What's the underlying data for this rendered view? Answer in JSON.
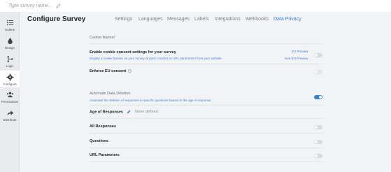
{
  "topbar": {
    "survey_placeholder": "Type survey name..."
  },
  "sidebar": {
    "items": [
      {
        "label": "Outline",
        "icon": "list-icon"
      },
      {
        "label": "Design",
        "icon": "droplet-icon"
      },
      {
        "label": "Logic",
        "icon": "logic-icon"
      },
      {
        "label": "Configure",
        "icon": "gear-icon",
        "active": true
      },
      {
        "label": "Permissions",
        "icon": "users-icon"
      },
      {
        "label": "Distribute",
        "icon": "share-icon"
      }
    ]
  },
  "header": {
    "title": "Configure Survey",
    "tabs": [
      "Settings",
      "Languages",
      "Messages",
      "Labels",
      "Integrations",
      "Webhooks",
      "Data Privacy"
    ],
    "active_tab": "Data Privacy"
  },
  "cookie": {
    "section_title": "Cookie Banner",
    "enable_label": "Enable cookie consent settings for your survey",
    "enable_sub_a": "Display a cookie banner on your survey",
    "enable_sub_or": "or",
    "enable_sub_b": "pass consent as URL parameters from your website",
    "eu_preview": "EU Preview",
    "non_eu_preview": "Non-EU Preview",
    "enforce_label": "Enforce EU consent",
    "enable_on": false,
    "enforce_on": false
  },
  "deletion": {
    "section_title": "Automate Data Deletion",
    "section_sub": "Automate the deletion of responses to specific questions based on the age of response",
    "automate_on": true,
    "age_label": "Age of Responses",
    "age_value": "None defined",
    "rows": [
      {
        "label": "All Responses",
        "on": false
      },
      {
        "label": "Questions",
        "on": false
      },
      {
        "label": "URL Parameters",
        "on": false
      }
    ]
  },
  "colors": {
    "accent": "#3b82d6",
    "toggle_off": "#d7dbe0"
  }
}
